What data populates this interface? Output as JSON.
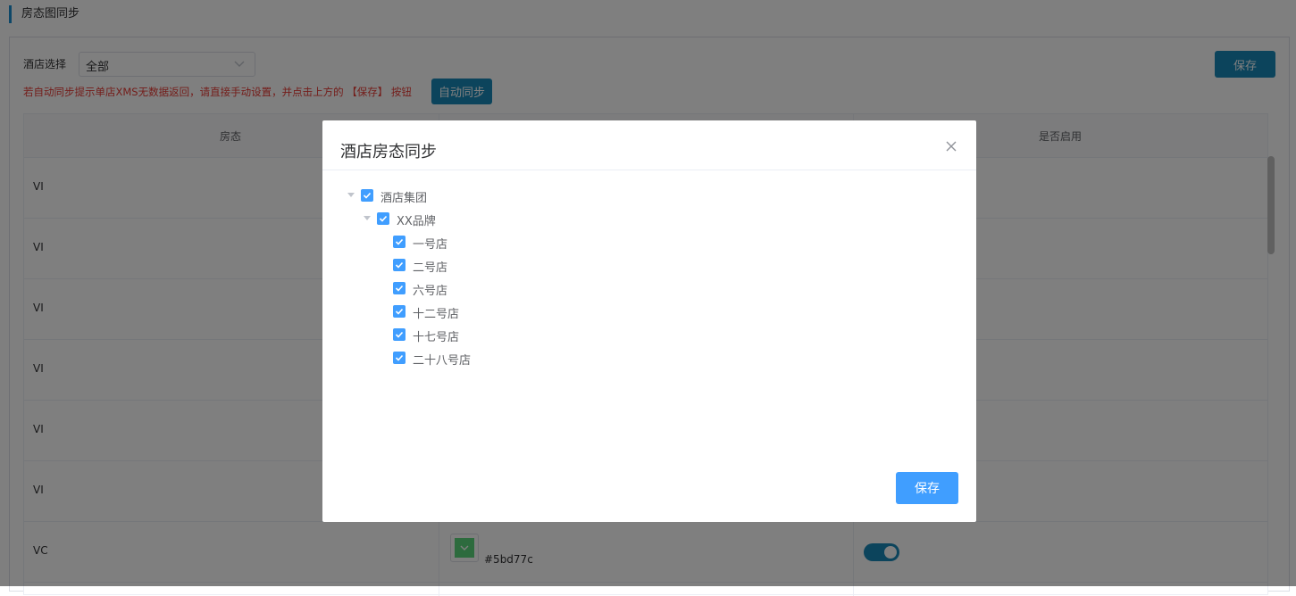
{
  "page": {
    "title": "房态图同步",
    "filter_label": "酒店选择",
    "hotel_select_value": "全部",
    "hint": "若自动同步提示单店XMS无数据返回，请直接手动设置，并点击上方的 【保存】 按钮",
    "auto_sync_label": "自动同步",
    "save_label": "保存"
  },
  "table": {
    "headers": {
      "status": "房态",
      "enabled": "是否启用"
    },
    "rows": [
      {
        "status": "VI"
      },
      {
        "status": "VI"
      },
      {
        "status": "VI"
      },
      {
        "status": "VI"
      },
      {
        "status": "VI"
      },
      {
        "status": "VI"
      },
      {
        "status": "VC",
        "color_hex": "#5bd77c",
        "enabled": true
      }
    ]
  },
  "dialog": {
    "title": "酒店房态同步",
    "save_label": "保存",
    "tree": {
      "root": {
        "label": "酒店集团",
        "checked": true,
        "expanded": true
      },
      "brand": {
        "label": "XX品牌",
        "checked": true,
        "expanded": true
      },
      "stores": [
        {
          "label": "一号店",
          "checked": true
        },
        {
          "label": "二号店",
          "checked": true
        },
        {
          "label": "六号店",
          "checked": true
        },
        {
          "label": "十二号店",
          "checked": true
        },
        {
          "label": "十七号店",
          "checked": true
        },
        {
          "label": "二十八号店",
          "checked": true
        }
      ]
    }
  },
  "colors": {
    "accent": "#1989b8",
    "primary": "#409eff",
    "hint_text": "#e83a34",
    "overlay": "rgba(0,0,0,0.5)"
  }
}
